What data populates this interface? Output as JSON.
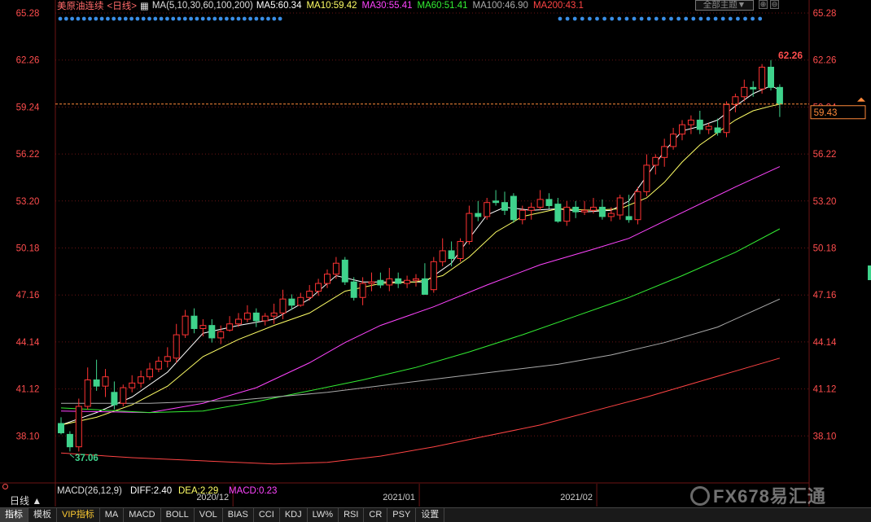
{
  "header": {
    "title": "美原油连续",
    "period_tag": "<日线>",
    "ma_params": "MA(5,10,30,60,100,200)",
    "ma": [
      {
        "label": "MA5:60.34",
        "color": "#ffffff"
      },
      {
        "label": "MA10:59.42",
        "color": "#ffff66"
      },
      {
        "label": "MA30:55.41",
        "color": "#ff44ff"
      },
      {
        "label": "MA60:51.41",
        "color": "#33ee33"
      },
      {
        "label": "MA100:46.90",
        "color": "#aaaaaa"
      },
      {
        "label": "MA200:43.1",
        "color": "#ff4444"
      }
    ],
    "theme_button": "全部主题▼",
    "mini_buttons": [
      "⊕",
      "⊖"
    ]
  },
  "chart_data": {
    "type": "candlestick",
    "symbol": "美原油连续",
    "y_ticks": [
      "65.28",
      "62.26",
      "59.24",
      "56.22",
      "53.20",
      "50.18",
      "47.16",
      "44.14",
      "41.12",
      "38.10"
    ],
    "ylim": [
      36.2,
      65.28
    ],
    "x_labels": [
      {
        "label": "2020/12",
        "index": 18
      },
      {
        "label": "2021/01",
        "index": 39
      },
      {
        "label": "2021/02",
        "index": 59
      }
    ],
    "current_price": "59.43",
    "high_label": "62.26",
    "low_label": "37.06",
    "up_color": "#ff3333",
    "down_color": "#3fd38c",
    "candles": [
      {
        "o": 38.9,
        "h": 39.3,
        "l": 38.2,
        "c": 38.3
      },
      {
        "o": 38.2,
        "h": 38.4,
        "l": 37.1,
        "c": 37.4
      },
      {
        "o": 37.4,
        "h": 40.5,
        "l": 37.1,
        "c": 40.0
      },
      {
        "o": 40.0,
        "h": 42.5,
        "l": 39.8,
        "c": 41.7
      },
      {
        "o": 41.7,
        "h": 43.0,
        "l": 41.0,
        "c": 41.3
      },
      {
        "o": 41.3,
        "h": 42.4,
        "l": 40.6,
        "c": 41.9
      },
      {
        "o": 40.9,
        "h": 41.6,
        "l": 39.8,
        "c": 40.1
      },
      {
        "o": 40.2,
        "h": 41.4,
        "l": 40.0,
        "c": 41.2
      },
      {
        "o": 41.2,
        "h": 42.0,
        "l": 40.9,
        "c": 41.5
      },
      {
        "o": 41.5,
        "h": 42.3,
        "l": 41.2,
        "c": 41.9
      },
      {
        "o": 41.9,
        "h": 42.8,
        "l": 41.7,
        "c": 42.4
      },
      {
        "o": 42.4,
        "h": 43.2,
        "l": 42.2,
        "c": 42.9
      },
      {
        "o": 42.9,
        "h": 43.8,
        "l": 42.5,
        "c": 43.2
      },
      {
        "o": 43.1,
        "h": 45.3,
        "l": 42.8,
        "c": 44.6
      },
      {
        "o": 44.6,
        "h": 46.2,
        "l": 44.4,
        "c": 45.8
      },
      {
        "o": 45.8,
        "h": 46.3,
        "l": 44.7,
        "c": 45.0
      },
      {
        "o": 45.0,
        "h": 45.6,
        "l": 44.5,
        "c": 45.2
      },
      {
        "o": 45.2,
        "h": 45.6,
        "l": 44.1,
        "c": 44.4
      },
      {
        "o": 44.4,
        "h": 45.2,
        "l": 44.0,
        "c": 44.8
      },
      {
        "o": 44.9,
        "h": 45.8,
        "l": 44.8,
        "c": 45.3
      },
      {
        "o": 45.3,
        "h": 46.0,
        "l": 45.1,
        "c": 45.6
      },
      {
        "o": 45.6,
        "h": 46.5,
        "l": 45.4,
        "c": 46.0
      },
      {
        "o": 46.0,
        "h": 46.3,
        "l": 45.1,
        "c": 45.5
      },
      {
        "o": 45.5,
        "h": 46.0,
        "l": 45.2,
        "c": 45.8
      },
      {
        "o": 45.8,
        "h": 46.6,
        "l": 45.3,
        "c": 46.0
      },
      {
        "o": 46.0,
        "h": 47.5,
        "l": 45.6,
        "c": 46.9
      },
      {
        "o": 46.9,
        "h": 47.2,
        "l": 46.2,
        "c": 46.5
      },
      {
        "o": 46.5,
        "h": 47.3,
        "l": 46.4,
        "c": 47.0
      },
      {
        "o": 47.0,
        "h": 47.8,
        "l": 46.8,
        "c": 47.4
      },
      {
        "o": 47.4,
        "h": 48.2,
        "l": 47.1,
        "c": 47.9
      },
      {
        "o": 47.9,
        "h": 48.8,
        "l": 47.6,
        "c": 48.5
      },
      {
        "o": 48.5,
        "h": 49.6,
        "l": 48.2,
        "c": 49.2
      },
      {
        "o": 49.4,
        "h": 49.6,
        "l": 47.8,
        "c": 48.0
      },
      {
        "o": 48.0,
        "h": 48.3,
        "l": 46.8,
        "c": 47.0
      },
      {
        "o": 47.0,
        "h": 48.3,
        "l": 46.5,
        "c": 47.9
      },
      {
        "o": 47.9,
        "h": 48.6,
        "l": 47.4,
        "c": 48.0
      },
      {
        "o": 48.1,
        "h": 48.6,
        "l": 47.6,
        "c": 47.8
      },
      {
        "o": 47.8,
        "h": 48.9,
        "l": 47.4,
        "c": 48.2
      },
      {
        "o": 48.2,
        "h": 48.6,
        "l": 47.6,
        "c": 47.9
      },
      {
        "o": 47.9,
        "h": 48.4,
        "l": 47.6,
        "c": 48.1
      },
      {
        "o": 48.1,
        "h": 48.5,
        "l": 47.7,
        "c": 48.2
      },
      {
        "o": 48.2,
        "h": 49.2,
        "l": 47.4,
        "c": 47.2
      },
      {
        "o": 47.5,
        "h": 49.6,
        "l": 47.3,
        "c": 49.3
      },
      {
        "o": 49.3,
        "h": 50.8,
        "l": 49.0,
        "c": 50.0
      },
      {
        "o": 50.0,
        "h": 50.6,
        "l": 49.0,
        "c": 49.5
      },
      {
        "o": 49.5,
        "h": 50.8,
        "l": 49.3,
        "c": 50.6
      },
      {
        "o": 50.6,
        "h": 52.9,
        "l": 50.4,
        "c": 52.4
      },
      {
        "o": 52.4,
        "h": 53.2,
        "l": 51.9,
        "c": 52.2
      },
      {
        "o": 52.2,
        "h": 53.4,
        "l": 52.0,
        "c": 53.1
      },
      {
        "o": 53.2,
        "h": 53.9,
        "l": 52.9,
        "c": 53.1
      },
      {
        "o": 53.1,
        "h": 53.8,
        "l": 52.3,
        "c": 52.6
      },
      {
        "o": 53.5,
        "h": 53.7,
        "l": 51.8,
        "c": 52.0
      },
      {
        "o": 52.0,
        "h": 52.9,
        "l": 51.7,
        "c": 52.6
      },
      {
        "o": 52.6,
        "h": 53.1,
        "l": 52.0,
        "c": 52.8
      },
      {
        "o": 52.8,
        "h": 53.9,
        "l": 52.6,
        "c": 53.3
      },
      {
        "o": 53.3,
        "h": 53.7,
        "l": 52.7,
        "c": 52.9
      },
      {
        "o": 53.0,
        "h": 53.4,
        "l": 51.8,
        "c": 51.9
      },
      {
        "o": 51.9,
        "h": 53.2,
        "l": 51.6,
        "c": 52.8
      },
      {
        "o": 52.8,
        "h": 53.2,
        "l": 52.1,
        "c": 52.5
      },
      {
        "o": 52.5,
        "h": 53.2,
        "l": 52.3,
        "c": 52.6
      },
      {
        "o": 52.6,
        "h": 53.4,
        "l": 52.4,
        "c": 52.8
      },
      {
        "o": 52.8,
        "h": 53.3,
        "l": 52.0,
        "c": 52.2
      },
      {
        "o": 52.2,
        "h": 52.8,
        "l": 51.9,
        "c": 52.4
      },
      {
        "o": 52.3,
        "h": 53.6,
        "l": 52.0,
        "c": 53.4
      },
      {
        "o": 52.2,
        "h": 53.6,
        "l": 51.8,
        "c": 52.0
      },
      {
        "o": 52.0,
        "h": 54.1,
        "l": 51.7,
        "c": 53.8
      },
      {
        "o": 53.8,
        "h": 56.2,
        "l": 53.5,
        "c": 55.5
      },
      {
        "o": 55.5,
        "h": 56.2,
        "l": 54.9,
        "c": 56.0
      },
      {
        "o": 56.0,
        "h": 57.2,
        "l": 55.4,
        "c": 56.7
      },
      {
        "o": 56.7,
        "h": 57.9,
        "l": 56.5,
        "c": 57.5
      },
      {
        "o": 57.5,
        "h": 58.4,
        "l": 57.1,
        "c": 58.1
      },
      {
        "o": 58.1,
        "h": 58.7,
        "l": 57.5,
        "c": 58.4
      },
      {
        "o": 58.4,
        "h": 59.0,
        "l": 57.5,
        "c": 57.8
      },
      {
        "o": 57.8,
        "h": 58.2,
        "l": 57.5,
        "c": 58.0
      },
      {
        "o": 57.9,
        "h": 58.5,
        "l": 57.4,
        "c": 57.6
      },
      {
        "o": 57.6,
        "h": 59.6,
        "l": 57.3,
        "c": 59.4
      },
      {
        "o": 59.4,
        "h": 60.1,
        "l": 58.9,
        "c": 59.9
      },
      {
        "o": 59.9,
        "h": 61.0,
        "l": 59.6,
        "c": 60.5
      },
      {
        "o": 60.5,
        "h": 60.9,
        "l": 59.9,
        "c": 60.4
      },
      {
        "o": 60.4,
        "h": 62.0,
        "l": 60.1,
        "c": 61.8
      },
      {
        "o": 61.8,
        "h": 62.26,
        "l": 60.3,
        "c": 60.5
      },
      {
        "o": 60.5,
        "h": 60.7,
        "l": 58.6,
        "c": 59.43
      }
    ],
    "ma_lines": [
      {
        "color": "#ffffff",
        "pts": [
          [
            0,
            38.8
          ],
          [
            4,
            39.6
          ],
          [
            8,
            40.6
          ],
          [
            12,
            42.2
          ],
          [
            16,
            44.7
          ],
          [
            20,
            45.2
          ],
          [
            24,
            45.6
          ],
          [
            28,
            46.9
          ],
          [
            31,
            48.4
          ],
          [
            34,
            48.0
          ],
          [
            38,
            48.0
          ],
          [
            41,
            48.0
          ],
          [
            44,
            49.2
          ],
          [
            46,
            50.8
          ],
          [
            48,
            52.3
          ],
          [
            50,
            52.8
          ],
          [
            53,
            52.6
          ],
          [
            56,
            52.7
          ],
          [
            59,
            52.5
          ],
          [
            62,
            52.6
          ],
          [
            64,
            53.2
          ],
          [
            66,
            54.8
          ],
          [
            68,
            56.4
          ],
          [
            70,
            57.7
          ],
          [
            72,
            58.0
          ],
          [
            74,
            58.4
          ],
          [
            76,
            59.3
          ],
          [
            78,
            60.1
          ],
          [
            80,
            60.6
          ],
          [
            81,
            60.34
          ]
        ]
      },
      {
        "color": "#ffff66",
        "pts": [
          [
            0,
            38.8
          ],
          [
            4,
            39.3
          ],
          [
            8,
            40.1
          ],
          [
            12,
            41.3
          ],
          [
            16,
            43.2
          ],
          [
            20,
            44.3
          ],
          [
            24,
            45.2
          ],
          [
            28,
            46.0
          ],
          [
            32,
            47.4
          ],
          [
            36,
            47.9
          ],
          [
            40,
            48.0
          ],
          [
            43,
            48.4
          ],
          [
            46,
            49.6
          ],
          [
            49,
            51.2
          ],
          [
            52,
            52.2
          ],
          [
            56,
            52.7
          ],
          [
            60,
            52.6
          ],
          [
            63,
            52.7
          ],
          [
            66,
            53.4
          ],
          [
            68,
            54.4
          ],
          [
            70,
            55.7
          ],
          [
            72,
            56.8
          ],
          [
            74,
            57.6
          ],
          [
            76,
            58.4
          ],
          [
            78,
            59.0
          ],
          [
            80,
            59.3
          ],
          [
            81,
            59.42
          ]
        ]
      },
      {
        "color": "#ff44ff",
        "pts": [
          [
            0,
            39.7
          ],
          [
            10,
            39.6
          ],
          [
            16,
            40.2
          ],
          [
            22,
            41.2
          ],
          [
            28,
            42.8
          ],
          [
            32,
            44.1
          ],
          [
            36,
            45.2
          ],
          [
            42,
            46.4
          ],
          [
            48,
            47.8
          ],
          [
            54,
            49.1
          ],
          [
            60,
            50.1
          ],
          [
            64,
            50.8
          ],
          [
            68,
            51.9
          ],
          [
            72,
            53.0
          ],
          [
            76,
            54.1
          ],
          [
            81,
            55.41
          ]
        ]
      },
      {
        "color": "#33ee33",
        "pts": [
          [
            0,
            39.9
          ],
          [
            10,
            39.6
          ],
          [
            16,
            39.7
          ],
          [
            22,
            40.3
          ],
          [
            28,
            41.0
          ],
          [
            34,
            41.7
          ],
          [
            40,
            42.5
          ],
          [
            46,
            43.5
          ],
          [
            52,
            44.6
          ],
          [
            58,
            45.8
          ],
          [
            64,
            47.0
          ],
          [
            70,
            48.4
          ],
          [
            76,
            49.9
          ],
          [
            81,
            51.41
          ]
        ]
      },
      {
        "color": "#aaaaaa",
        "pts": [
          [
            0,
            40.2
          ],
          [
            10,
            40.2
          ],
          [
            20,
            40.4
          ],
          [
            30,
            40.9
          ],
          [
            40,
            41.6
          ],
          [
            50,
            42.3
          ],
          [
            56,
            42.7
          ],
          [
            62,
            43.3
          ],
          [
            68,
            44.1
          ],
          [
            74,
            45.1
          ],
          [
            81,
            46.9
          ]
        ]
      },
      {
        "color": "#ff4444",
        "pts": [
          [
            0,
            37.0
          ],
          [
            8,
            36.7
          ],
          [
            16,
            36.5
          ],
          [
            24,
            36.3
          ],
          [
            30,
            36.4
          ],
          [
            36,
            36.8
          ],
          [
            42,
            37.4
          ],
          [
            48,
            38.1
          ],
          [
            54,
            38.8
          ],
          [
            60,
            39.7
          ],
          [
            66,
            40.6
          ],
          [
            72,
            41.6
          ],
          [
            78,
            42.6
          ],
          [
            81,
            43.1
          ]
        ]
      }
    ]
  },
  "macd": {
    "label": "MACD(26,12,9)",
    "diff": "DIFF:2.40",
    "dea": "DEA:2.29",
    "macd": "MACD:0.23",
    "diff_color": "#ffffff",
    "dea_color": "#ffff66",
    "macd_color": "#ff44ff"
  },
  "period_selector": "日线 ▲",
  "watermark": "FX678易汇通",
  "tabs": [
    "指标",
    "模板",
    "VIP指标",
    "MA",
    "MACD",
    "BOLL",
    "VOL",
    "BIAS",
    "CCI",
    "KDJ",
    "LW%",
    "RSI",
    "CR",
    "PSY",
    "设置"
  ],
  "active_tab": "指标",
  "vip_tab": "VIP指标",
  "colors": {
    "grid": "#6b1515",
    "axis_text": "#ff4d4d",
    "dot_row": "#3a8ee6",
    "price_line": "#ff8a3a"
  }
}
